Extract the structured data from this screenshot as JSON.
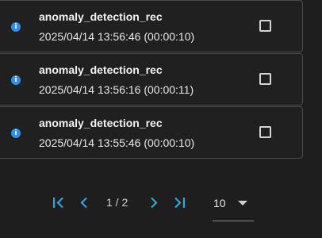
{
  "records": [
    {
      "title": "anomaly_detection_rec",
      "timestamp": "2025/04/14 13:56:46 (00:00:10)",
      "icon": "info-icon",
      "checked": false
    },
    {
      "title": "anomaly_detection_rec",
      "timestamp": "2025/04/14 13:56:16 (00:00:11)",
      "icon": "info-icon",
      "checked": false
    },
    {
      "title": "anomaly_detection_rec",
      "timestamp": "2025/04/14 13:55:46 (00:00:10)",
      "icon": "info-icon",
      "checked": false
    }
  ],
  "pagination": {
    "page_indicator": "1 / 2",
    "rows_per_page": "10",
    "icons": [
      "first-page-icon",
      "previous-page-icon",
      "next-page-icon",
      "last-page-icon",
      "chevron-down-icon"
    ]
  },
  "colors": {
    "background": "#1e1e1e",
    "card": "#202020",
    "card_border": "#4a4a4a",
    "info_icon": "#2f8ff0",
    "pager_icon": "#2aa7d6"
  }
}
